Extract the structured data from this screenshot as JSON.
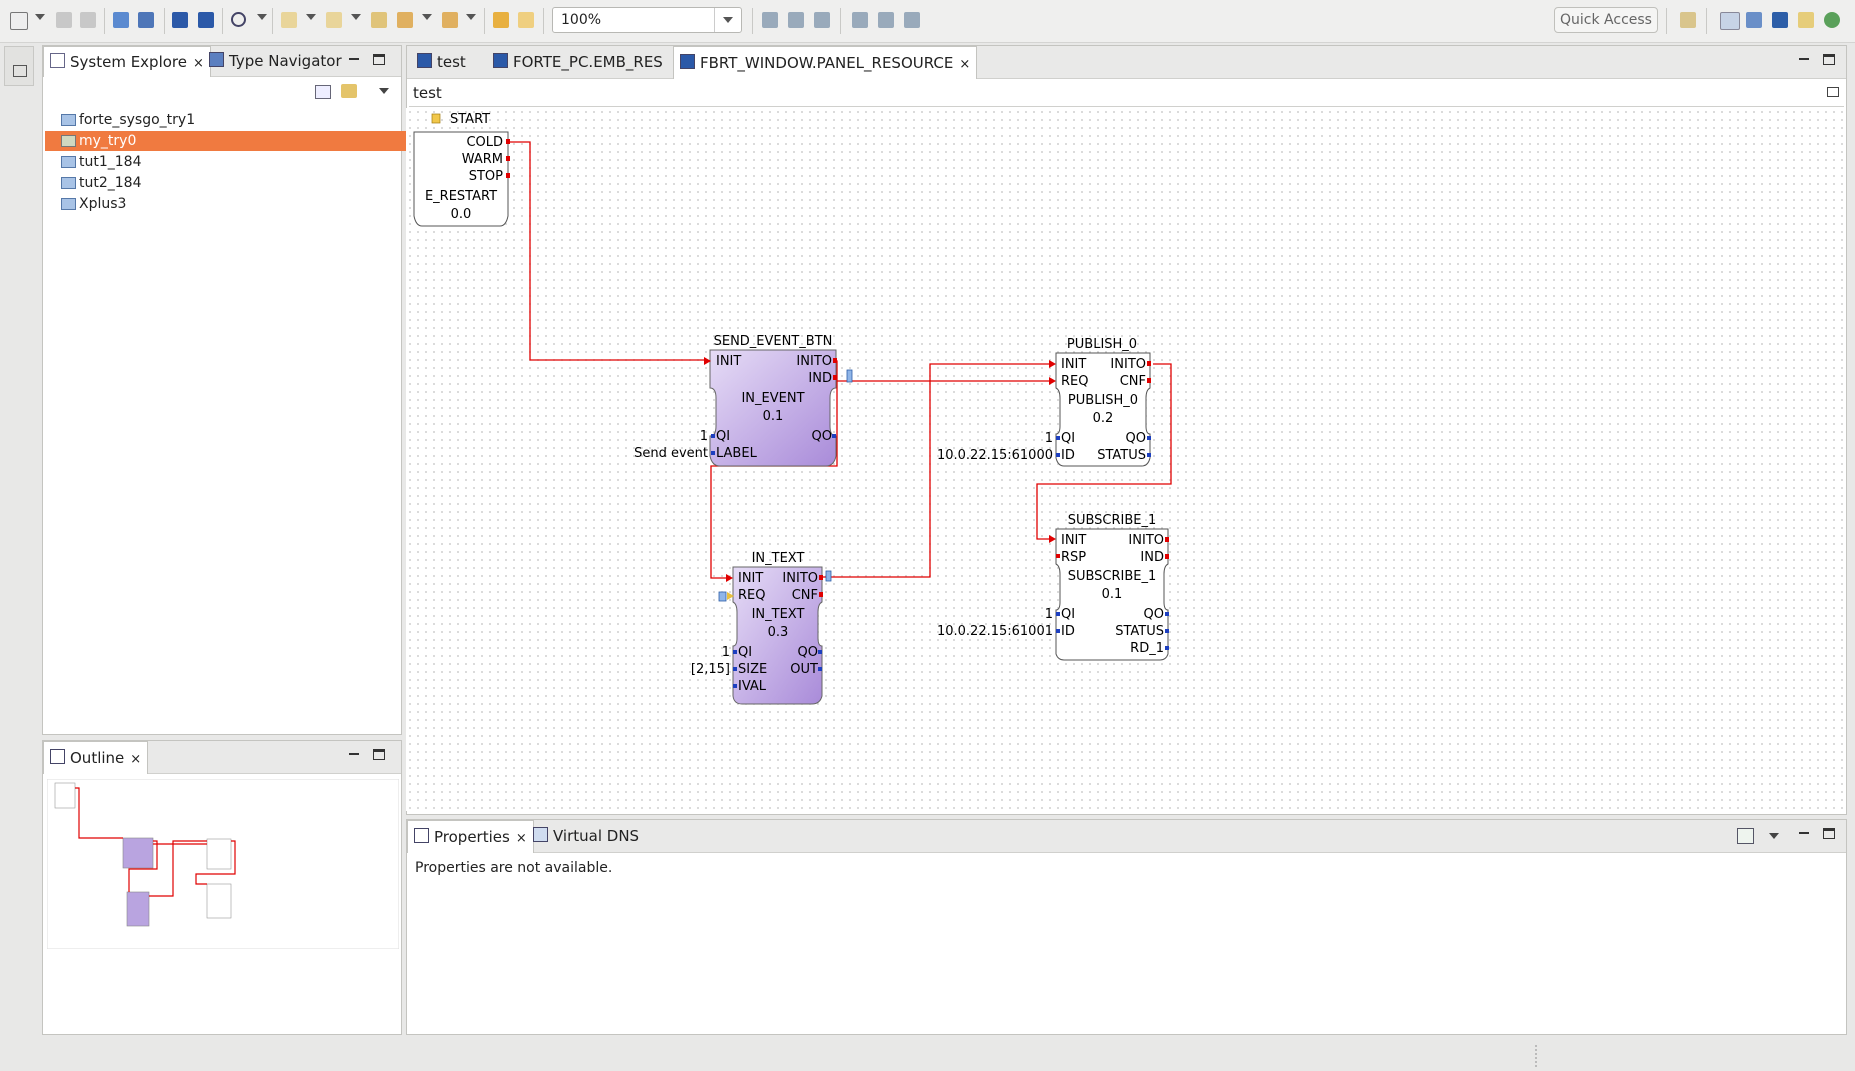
{
  "toolbar": {
    "zoom_value": "100%",
    "quick_access": "Quick Access",
    "icons": [
      "new-icon",
      "save-icon",
      "save-all-icon",
      "print-icon",
      "build-icon",
      "download-icon",
      "upload-icon",
      "search-icon",
      "next-annotation-icon",
      "prev-annotation-icon",
      "last-edit-icon",
      "back-icon",
      "forward-icon",
      "undo-icon",
      "redo-icon",
      "align-left-icon",
      "align-center-icon",
      "align-right-icon",
      "align-top-icon",
      "align-middle-icon",
      "align-bottom-icon",
      "perspective-icon",
      "system-perspective-icon",
      "deployment-perspective-icon",
      "debug-perspective-icon",
      "tool-perspective-icon"
    ]
  },
  "left_trim": {
    "icon": "restore-icon"
  },
  "explorer": {
    "tabs": [
      {
        "label": "System Explore",
        "icon": "tree-icon",
        "closable": true
      },
      {
        "label": "Type Navigator",
        "icon": "type-icon",
        "closable": false
      }
    ],
    "items": [
      {
        "label": "forte_sysgo_try1",
        "selected": false
      },
      {
        "label": "my_try0",
        "selected": true
      },
      {
        "label": "tut1_184",
        "selected": false
      },
      {
        "label": "tut2_184",
        "selected": false
      },
      {
        "label": "Xplus3",
        "selected": false
      }
    ]
  },
  "outline": {
    "title": "Outline"
  },
  "editor": {
    "tabs": [
      {
        "label": "test",
        "active": false
      },
      {
        "label": "FORTE_PC.EMB_RES",
        "active": false
      },
      {
        "label": "FBRT_WINDOW.PANEL_RESOURCE",
        "active": true
      }
    ],
    "breadcrumb": "test"
  },
  "diagram": {
    "blocks": [
      {
        "id": "start",
        "title": "START",
        "name": "E_RESTART",
        "version": "0.0",
        "events_out": [
          "COLD",
          "WARM",
          "STOP"
        ]
      },
      {
        "id": "send",
        "title": "SEND_EVENT_BTN",
        "name": "IN_EVENT",
        "version": "0.1",
        "events_in": [
          "INIT"
        ],
        "events_out": [
          "INITO",
          "IND"
        ],
        "data_in": [
          "QI",
          "LABEL"
        ],
        "data_out": [
          "QO"
        ],
        "params": {
          "QI": "1",
          "LABEL": "Send event"
        }
      },
      {
        "id": "publish",
        "title": "PUBLISH_0",
        "name": "PUBLISH_0",
        "version": "0.2",
        "events_in": [
          "INIT",
          "REQ"
        ],
        "events_out": [
          "INITO",
          "CNF"
        ],
        "data_in": [
          "QI",
          "ID"
        ],
        "data_out": [
          "QO",
          "STATUS"
        ],
        "params": {
          "QI": "1",
          "ID": "10.0.22.15:61000"
        }
      },
      {
        "id": "subscribe",
        "title": "SUBSCRIBE_1",
        "name": "SUBSCRIBE_1",
        "version": "0.1",
        "events_in": [
          "INIT",
          "RSP"
        ],
        "events_out": [
          "INITO",
          "IND"
        ],
        "data_in": [
          "QI",
          "ID"
        ],
        "data_out": [
          "QO",
          "STATUS",
          "RD_1"
        ],
        "params": {
          "QI": "1",
          "ID": "10.0.22.15:61001"
        }
      },
      {
        "id": "intext",
        "title": "IN_TEXT",
        "name": "IN_TEXT",
        "version": "0.3",
        "events_in": [
          "INIT",
          "REQ"
        ],
        "events_out": [
          "INITO",
          "CNF"
        ],
        "data_in": [
          "QI",
          "SIZE",
          "IVAL"
        ],
        "data_out": [
          "QO",
          "OUT"
        ],
        "params": {
          "QI": "1",
          "SIZE": "[2,15]"
        }
      }
    ]
  },
  "properties": {
    "tabs": [
      {
        "label": "Properties",
        "active": true
      },
      {
        "label": "Virtual DNS",
        "active": false
      }
    ],
    "message": "Properties are not available."
  },
  "colors": {
    "selection": "#f07a40",
    "connection": "#e00000",
    "fb_purple": "#c8b4e8"
  }
}
